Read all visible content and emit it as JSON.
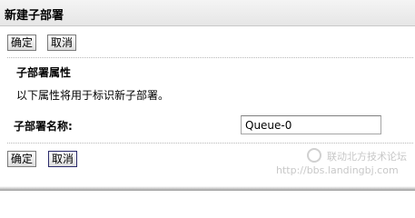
{
  "title": "新建子部署",
  "buttons": {
    "ok": "确定",
    "cancel": "取消"
  },
  "section": {
    "heading": "子部署属性",
    "description": "以下属性将用于标识新子部署。"
  },
  "form": {
    "name_label": "子部署名称:",
    "name_value": "Queue-0"
  },
  "watermark": {
    "text": "联动北方技术论坛",
    "url": "http://bbs.landingbj.com"
  }
}
